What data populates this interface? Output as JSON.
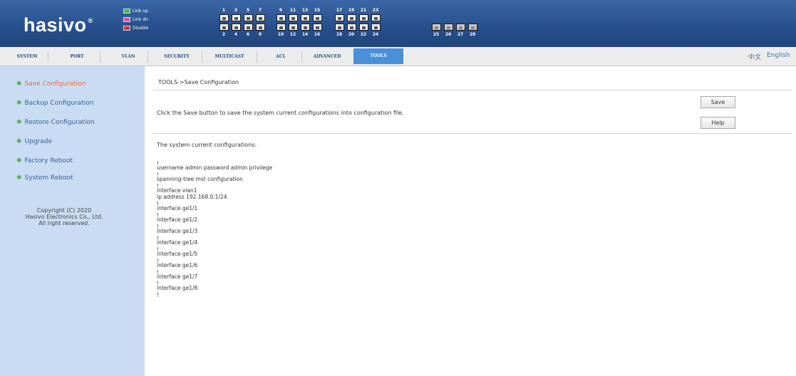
{
  "header": {
    "logo": "hasivo",
    "logo_mark": "®",
    "legend": [
      {
        "label": "Link up",
        "status": "up"
      },
      {
        "label": "Link dn",
        "status": "down"
      },
      {
        "label": "Disable",
        "status": "dis"
      }
    ],
    "port_numbers_top": [
      "1",
      "3",
      "5",
      "7",
      "9",
      "11",
      "13",
      "15",
      "17",
      "19",
      "21",
      "23"
    ],
    "port_numbers_bottom": [
      "2",
      "4",
      "6",
      "8",
      "10",
      "12",
      "14",
      "16",
      "18",
      "20",
      "22",
      "24",
      "25",
      "26",
      "27",
      "28"
    ]
  },
  "nav": {
    "tabs": [
      "SYSTEM",
      "PORT",
      "VLAN",
      "SECURITY",
      "MULTICAST",
      "ACL",
      "ADVANCED",
      "TOOLS"
    ],
    "active_tab": "TOOLS",
    "lang_cn": "中文",
    "lang_en": "English"
  },
  "sidebar": {
    "items": [
      "Save Configuration",
      "Backup Configuration",
      "Restore Configuration",
      "Upgrade",
      "Factory Reboot",
      "System Reboot"
    ],
    "active_index": 0,
    "copyright": [
      "Copyright (C) 2020",
      "Hasivo Electronics Co., Ltd.",
      "All right reserved."
    ]
  },
  "main": {
    "breadcrumb": "TOOLS->Save Configuration",
    "description": "Click the Save button to save the system current configurations into configuration file.",
    "save_label": "Save",
    "help_label": "Help",
    "config_title": "The system current configurations:",
    "config_lines": [
      "!",
      "username admin password admin privilege",
      "!",
      "spanning-tree mst configuration",
      "!",
      "interface vlan1",
      " ip address 192.168.0.1/24",
      "!",
      "interface ge1/1",
      "!",
      "interface ge1/2",
      "!",
      "interface ge1/3",
      "!",
      "interface ge1/4",
      "!",
      "interface ge1/5",
      "!",
      "interface ge1/6",
      "!",
      "interface ge1/7",
      "!",
      "interface ge1/8",
      "!"
    ]
  },
  "colors": {
    "header_blue": "#2a5390",
    "sidebar_bg": "#c9dcf3",
    "active_tab": "#4a8fd9",
    "active_link": "#ef6a3e",
    "bullet_green": "#4fa845"
  }
}
